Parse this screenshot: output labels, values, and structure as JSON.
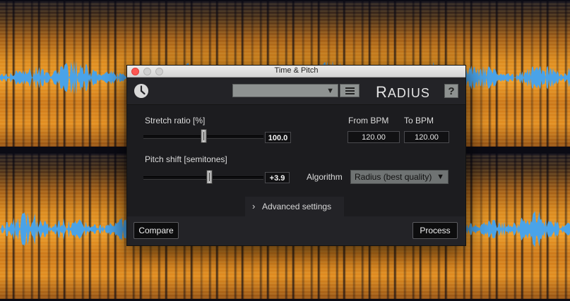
{
  "dialog": {
    "title": "Time & Pitch",
    "logo": {
      "first": "R",
      "rest": "ADIUS"
    },
    "help_label": "?",
    "preset_value": "",
    "stretch": {
      "label": "Stretch ratio [%]",
      "value": "100.0",
      "level": 0.5
    },
    "pitch": {
      "label": "Pitch shift [semitones]",
      "value": "+3.9",
      "level": 0.55
    },
    "bpm": {
      "from_label": "From BPM",
      "to_label": "To BPM",
      "from_value": "120.00",
      "to_value": "120.00"
    },
    "algorithm": {
      "label": "Algorithm",
      "selected": "Radius (best quality)"
    },
    "advanced_label": "Advanced settings",
    "compare_label": "Compare",
    "process_label": "Process"
  },
  "colors": {
    "waveform": "#4aa3e8",
    "spectrogram_hot": "#ee9a25",
    "close_button": "#fc5753",
    "dialog_bg": "#232327"
  },
  "icons": {
    "history": "clock-icon",
    "preset_dropdown": "triangle-down-icon",
    "preset_menu": "hamburger-menu-icon",
    "advanced": "chevron-right-icon",
    "algorithm_dropdown": "triangle-down-icon"
  }
}
